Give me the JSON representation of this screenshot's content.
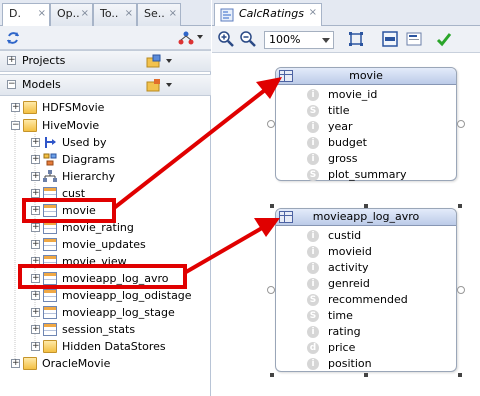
{
  "left_panel": {
    "tabs": [
      {
        "label": "D."
      },
      {
        "label": "Op.."
      },
      {
        "label": "To.."
      },
      {
        "label": "Se.."
      }
    ],
    "projects_label": "Projects",
    "models_label": "Models",
    "tree": [
      {
        "label": "HDFSMovie",
        "icon": "folder-icon"
      },
      {
        "label": "HiveMovie",
        "icon": "folder-icon"
      },
      {
        "label": "Used by",
        "icon": "used-by-icon"
      },
      {
        "label": "Diagrams",
        "icon": "diagrams-icon"
      },
      {
        "label": "Hierarchy",
        "icon": "hierarchy-icon"
      },
      {
        "label": "cust",
        "icon": "datastore-icon"
      },
      {
        "label": "movie",
        "icon": "datastore-icon"
      },
      {
        "label": "movie_rating",
        "icon": "datastore-icon"
      },
      {
        "label": "movie_updates",
        "icon": "datastore-icon"
      },
      {
        "label": "movie_view",
        "icon": "datastore-icon"
      },
      {
        "label": "movieapp_log_avro",
        "icon": "datastore-icon"
      },
      {
        "label": "movieapp_log_odistage",
        "icon": "datastore-icon"
      },
      {
        "label": "movieapp_log_stage",
        "icon": "datastore-icon"
      },
      {
        "label": "session_stats",
        "icon": "datastore-icon"
      },
      {
        "label": "Hidden DataStores",
        "icon": "folder-icon"
      },
      {
        "label": "OracleMovie",
        "icon": "folder-icon"
      }
    ]
  },
  "editor": {
    "tab_label": "CalcRatings",
    "zoom_value": "100%",
    "entities": [
      {
        "title": "movie",
        "columns": [
          {
            "name": "movie_id",
            "type": "i"
          },
          {
            "name": "title",
            "type": "S"
          },
          {
            "name": "year",
            "type": "i"
          },
          {
            "name": "budget",
            "type": "i"
          },
          {
            "name": "gross",
            "type": "i"
          },
          {
            "name": "plot_summary",
            "type": "S"
          }
        ]
      },
      {
        "title": "movieapp_log_avro",
        "columns": [
          {
            "name": "custid",
            "type": "i"
          },
          {
            "name": "movieid",
            "type": "i"
          },
          {
            "name": "activity",
            "type": "i"
          },
          {
            "name": "genreid",
            "type": "i"
          },
          {
            "name": "recommended",
            "type": "S"
          },
          {
            "name": "time",
            "type": "S"
          },
          {
            "name": "rating",
            "type": "i"
          },
          {
            "name": "price",
            "type": "d"
          },
          {
            "name": "position",
            "type": "i"
          }
        ]
      }
    ]
  },
  "colors": {
    "highlight": "#e00000",
    "header": "#bccbe8",
    "accent": "#4d63a3"
  }
}
